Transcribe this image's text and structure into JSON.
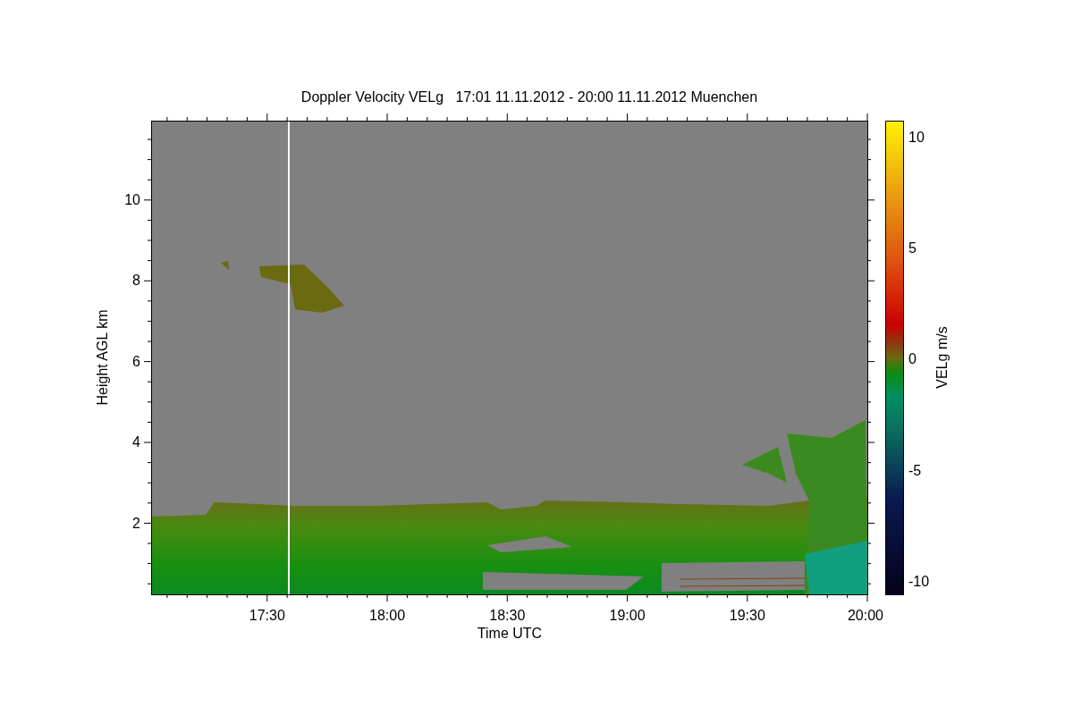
{
  "figure": {
    "title": "Doppler Velocity VELg   17:01 11.11.2012 - 20:00 11.11.2012 Muenchen",
    "y_axis": {
      "label": "Height AGL km",
      "ticks": [
        "10",
        "8",
        "6",
        "4",
        "2"
      ]
    },
    "x_axis": {
      "label": "Time UTC",
      "ticks": [
        "17:30",
        "18:00",
        "18:30",
        "19:00",
        "19:30",
        "20:00"
      ]
    },
    "colorbar": {
      "label": "VELg m/s",
      "ticks": [
        "10",
        "5",
        "0",
        "-5",
        "-10"
      ]
    }
  }
}
